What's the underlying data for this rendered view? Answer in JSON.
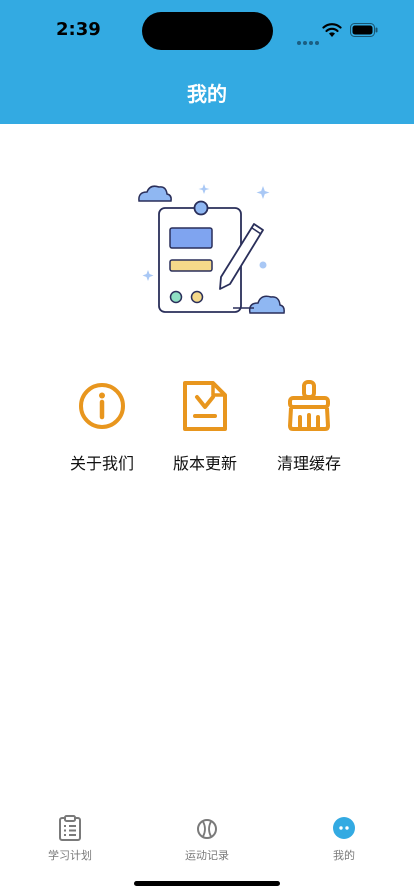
{
  "status_bar": {
    "time": "2:39"
  },
  "header": {
    "title": "我的"
  },
  "actions": [
    {
      "label": "关于我们",
      "icon": "info-circle-icon"
    },
    {
      "label": "版本更新",
      "icon": "document-download-icon"
    },
    {
      "label": "清理缓存",
      "icon": "broom-icon"
    }
  ],
  "tabbar": {
    "items": [
      {
        "label": "学习计划",
        "icon": "clipboard-list-icon",
        "active": false
      },
      {
        "label": "运动记录",
        "icon": "baseball-icon",
        "active": false
      },
      {
        "label": "我的",
        "icon": "chat-bubble-icon",
        "active": true
      }
    ]
  },
  "colors": {
    "header_bg": "#33aae2",
    "action_accent": "#e8961e",
    "tab_inactive": "#7a7a7a",
    "tab_active": "#33aae2"
  }
}
